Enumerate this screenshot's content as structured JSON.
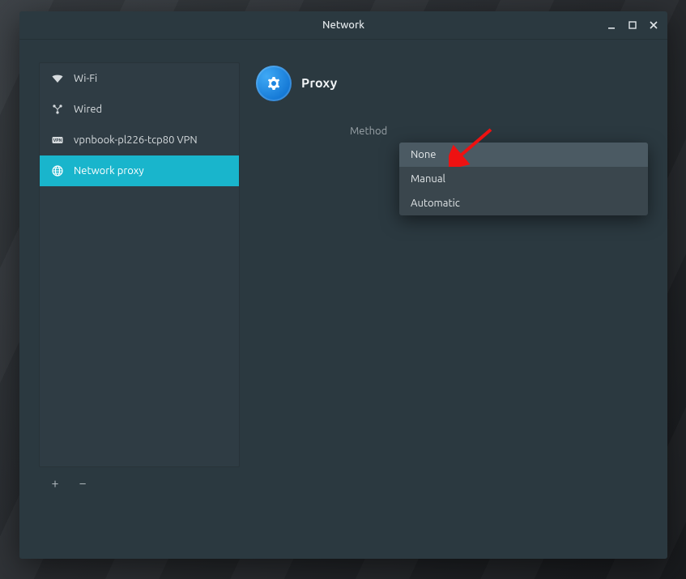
{
  "window": {
    "title": "Network"
  },
  "sidebar": {
    "items": [
      {
        "id": "wifi",
        "label": "Wi-Fi"
      },
      {
        "id": "wired",
        "label": "Wired"
      },
      {
        "id": "vpn",
        "label": "vpnbook-pl226-tcp80 VPN"
      },
      {
        "id": "proxy",
        "label": "Network proxy"
      }
    ],
    "active_index": 3
  },
  "main": {
    "title": "Proxy",
    "method_label": "Method",
    "method_options": [
      {
        "value": "none",
        "label": "None"
      },
      {
        "value": "manual",
        "label": "Manual"
      },
      {
        "value": "automatic",
        "label": "Automatic"
      }
    ],
    "method_selected_index": 0
  },
  "colors": {
    "accent": "#19b5cc",
    "proxy_icon_bg": "#1e86e0"
  }
}
